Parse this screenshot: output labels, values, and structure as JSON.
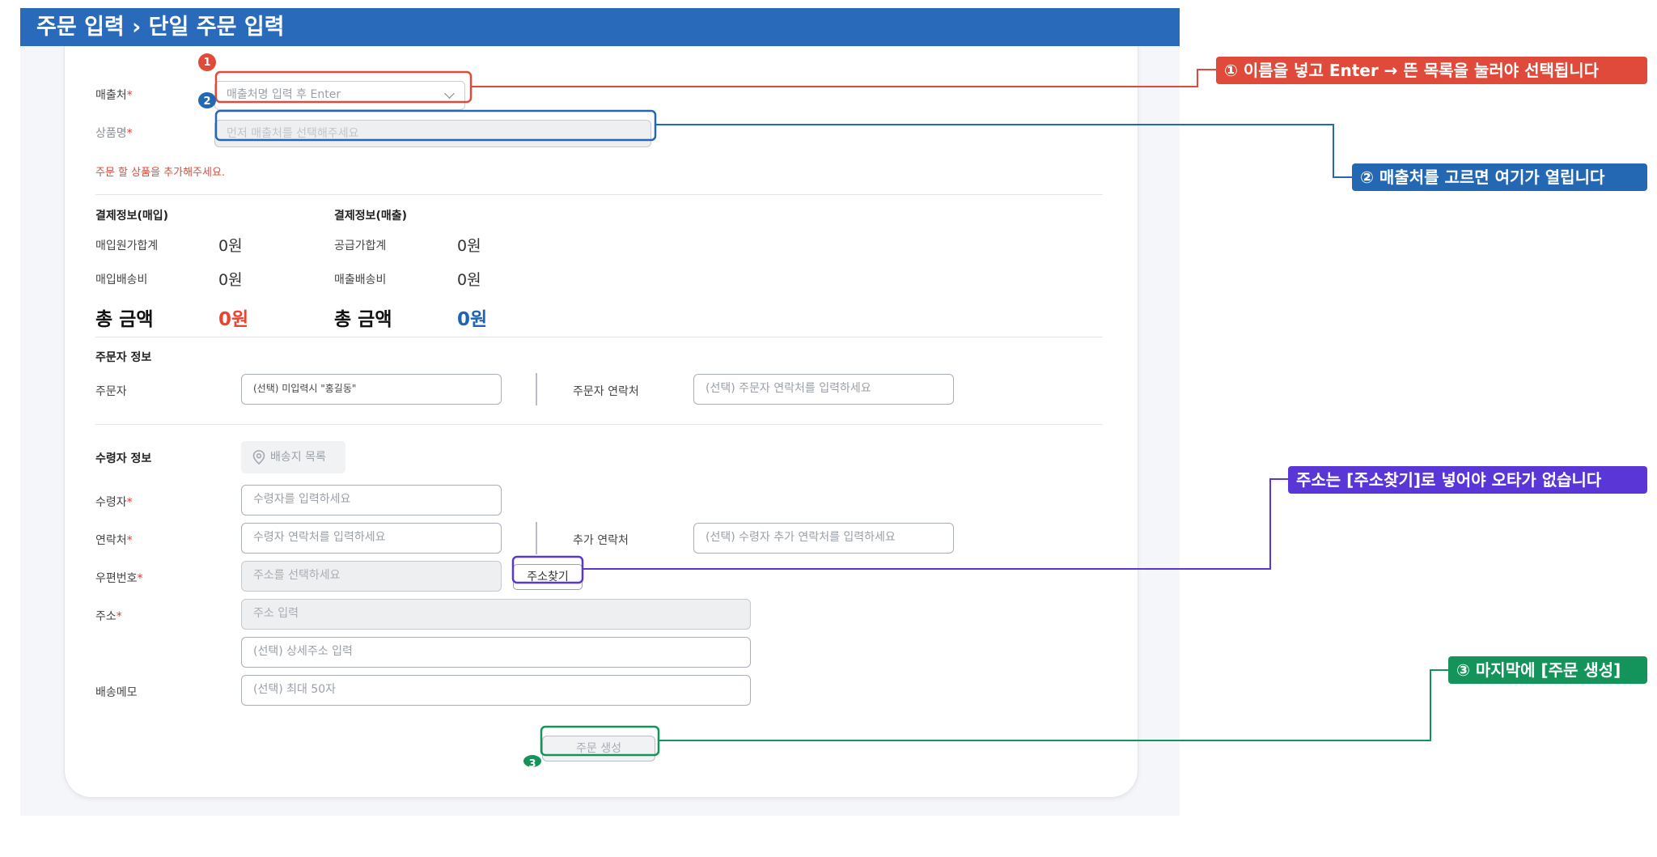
{
  "window": {
    "title": "주문 입력 › 단일 주문 입력"
  },
  "store": {
    "label": "매출처",
    "placeholder": "매출처명 입력 후 Enter"
  },
  "product": {
    "label": "상품명",
    "placeholder": "먼저 매출처를 선택해주세요"
  },
  "warning": "주문 할 상품을 추가해주세요.",
  "purchase": {
    "title": "결제정보(매입)",
    "cost_label": "매입원가합계",
    "cost_value": "0원",
    "ship_label": "매입배송비",
    "ship_value": "0원",
    "total_label": "총 금액",
    "total_value": "0원"
  },
  "sales": {
    "title": "결제정보(매출)",
    "supply_label": "공급가합계",
    "supply_value": "0원",
    "ship_label": "매출배송비",
    "ship_value": "0원",
    "total_label": "총 금액",
    "total_value": "0원"
  },
  "orderer": {
    "section": "주문자 정보",
    "name_label": "주문자",
    "name_placeholder": "(선택) 미입력시 \"홍길동\"",
    "phone_label": "주문자 연락처",
    "phone_placeholder": "(선택) 주문자 연락처를 입력하세요"
  },
  "receiver": {
    "section": "수령자 정보",
    "address_list_button": "배송지 목록",
    "name_label": "수령자",
    "name_placeholder": "수령자를 입력하세요",
    "phone_label": "연락처",
    "phone_placeholder": "수령자 연락처를 입력하세요",
    "extra_phone_label": "추가 연락처",
    "extra_phone_placeholder": "(선택) 수령자 추가 연락처를 입력하세요",
    "zip_label": "우편번호",
    "zip_placeholder": "주소를 선택하세요",
    "find_address_button": "주소찾기",
    "address_label": "주소",
    "address_placeholder": "주소 입력",
    "detail_placeholder": "(선택) 상세주소 입력",
    "memo_label": "배송메모",
    "memo_placeholder": "(선택) 최대 50자"
  },
  "submit_button": "주문 생성",
  "callouts": {
    "c1": "① 이름을 넣고 Enter → 뜬 목록을 눌러야 선택됩니다",
    "c2": "② 매출처를 고르면 여기가 열립니다",
    "c_addr": "주소는 [주소찾기]로 넣어야 오타가 없습니다",
    "c3": "③ 마지막에 [주문 생성]"
  },
  "badges": {
    "b1": "1",
    "b2": "2",
    "b3": "3"
  },
  "colors": {
    "header": "#2a6abb",
    "red": "#e04a3a",
    "blue": "#2468b4",
    "purple": "#5a36d6",
    "green": "#14935a"
  }
}
